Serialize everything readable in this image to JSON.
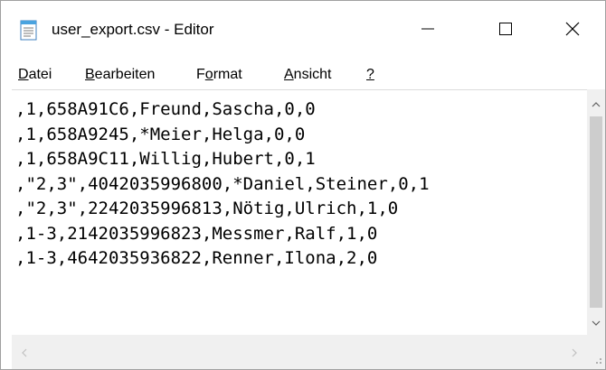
{
  "window": {
    "title": "user_export.csv - Editor"
  },
  "title_buttons": {
    "minimize_icon": "minimize-icon",
    "maximize_icon": "maximize-icon",
    "close_icon": "close-icon"
  },
  "menu": {
    "datei": {
      "accel": "D",
      "rest": "atei"
    },
    "bearbeiten": {
      "accel": "B",
      "rest": "earbeiten"
    },
    "format": {
      "pre": "F",
      "accel": "o",
      "rest": "rmat"
    },
    "ansicht": {
      "accel": "A",
      "rest": "nsicht"
    },
    "help": {
      "accel": "?"
    }
  },
  "editor": {
    "lines": [
      ",1,658A91C6,Freund,Sascha,0,0",
      ",1,658A9245,*Meier,Helga,0,0",
      ",1,658A9C11,Willig,Hubert,0,1",
      ",\"2,3\",4042035996800,*Daniel,Steiner,0,1",
      ",\"2,3\",2242035996813,Nötig,Ulrich,1,0",
      ",1-3,2142035996823,Messmer,Ralf,1,0",
      ",1-3,4642035936822,Renner,Ilona,2,0"
    ]
  },
  "colors": {
    "scrollbar_track": "#f0f0f0",
    "scrollbar_thumb": "#cdcdcd",
    "arrow": "#a0a0a0"
  }
}
